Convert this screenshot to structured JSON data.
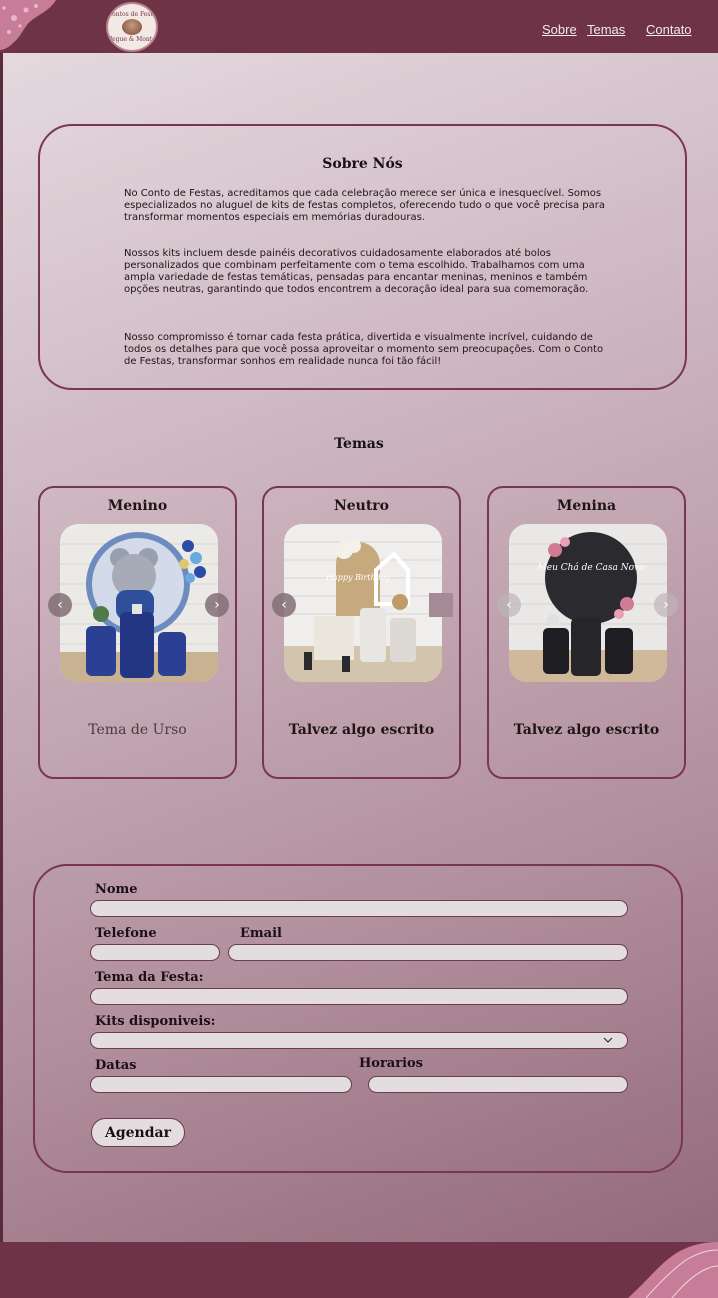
{
  "header": {
    "logo_text_top": "Contos de Festa",
    "logo_text_bottom": "Pegue & Monte",
    "nav": [
      {
        "label": "Sobre"
      },
      {
        "label": "Temas"
      },
      {
        "label": "Contato"
      }
    ]
  },
  "about": {
    "title": "Sobre Nós",
    "paragraphs": [
      "No Conto de Festas, acreditamos que cada celebração merece ser única e inesquecível. Somos especializados no aluguel de kits de festas completos, oferecendo tudo o que você precisa para transformar momentos especiais em memórias duradouras.",
      "Nossos kits incluem desde painéis decorativos cuidadosamente elaborados até bolos personalizados que combinam perfeitamente com o tema escolhido. Trabalhamos com uma ampla variedade de festas temáticas, pensadas para encantar meninas, meninos e também opções neutras, garantindo que todos encontrem a decoração ideal para sua comemoração.",
      "Nosso compromisso é tornar cada festa prática, divertida e visualmente incrível, cuidando de todos os detalhes para que você possa aproveitar o momento sem preocupações. Com o Conto de Festas, transformar sonhos em realidade nunca foi tão fácil!"
    ]
  },
  "temas": {
    "title": "Temas",
    "cards": [
      {
        "title": "Menino",
        "caption": "Tema de Urso",
        "image_text": ""
      },
      {
        "title": "Neutro",
        "caption": "Talvez algo escrito",
        "image_text": "Happy Birthday"
      },
      {
        "title": "Menina",
        "caption": "Talvez algo escrito",
        "image_text": "Meu Chá de Casa Nova"
      }
    ]
  },
  "form": {
    "labels": {
      "nome": "Nome",
      "telefone": "Telefone",
      "email": "Email",
      "tema": "Tema da Festa:",
      "kits": "Kits disponiveis:",
      "datas": "Datas",
      "horarios": "Horarios"
    },
    "values": {
      "nome": "",
      "telefone": "",
      "email": "",
      "tema": "",
      "kits": "",
      "datas": "",
      "horarios": ""
    },
    "submit_label": "Agendar"
  },
  "colors": {
    "brand": "#6f3347",
    "border": "#7a3650",
    "field_bg": "#e4dde0",
    "nav_text": "#f4e9ee"
  },
  "icons": [
    "chevron-left-icon",
    "chevron-right-icon",
    "chevron-down-icon"
  ]
}
